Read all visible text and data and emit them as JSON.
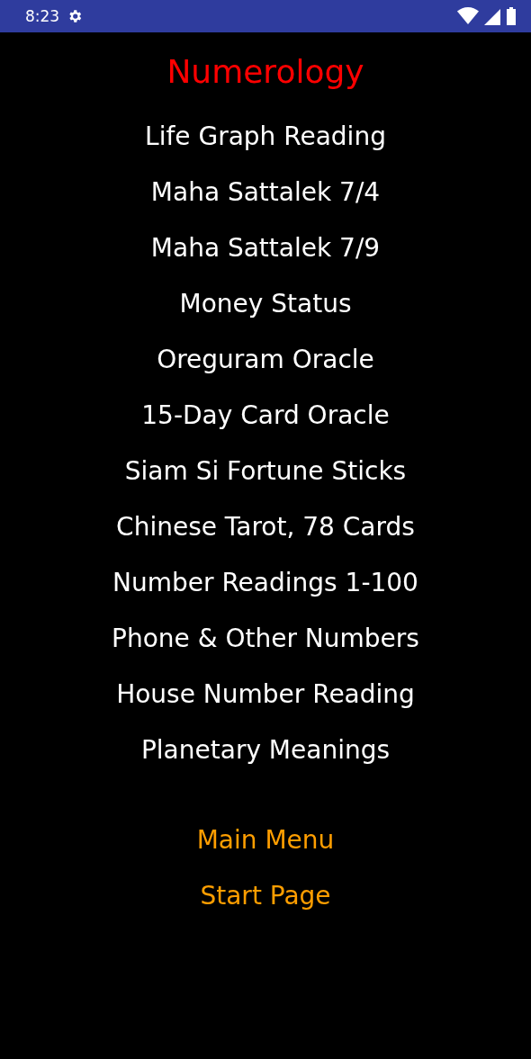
{
  "status_bar": {
    "time": "8:23"
  },
  "title": "Numerology",
  "items": [
    "Life Graph Reading",
    "Maha Sattalek 7/4",
    "Maha Sattalek 7/9",
    "Money Status",
    "Oreguram Oracle",
    "15-Day Card Oracle",
    "Siam Si Fortune Sticks",
    "Chinese Tarot, 78 Cards",
    "Number Readings 1-100",
    "Phone & Other Numbers",
    "House Number Reading",
    "Planetary Meanings"
  ],
  "links": [
    "Main Menu",
    "Start Page"
  ]
}
